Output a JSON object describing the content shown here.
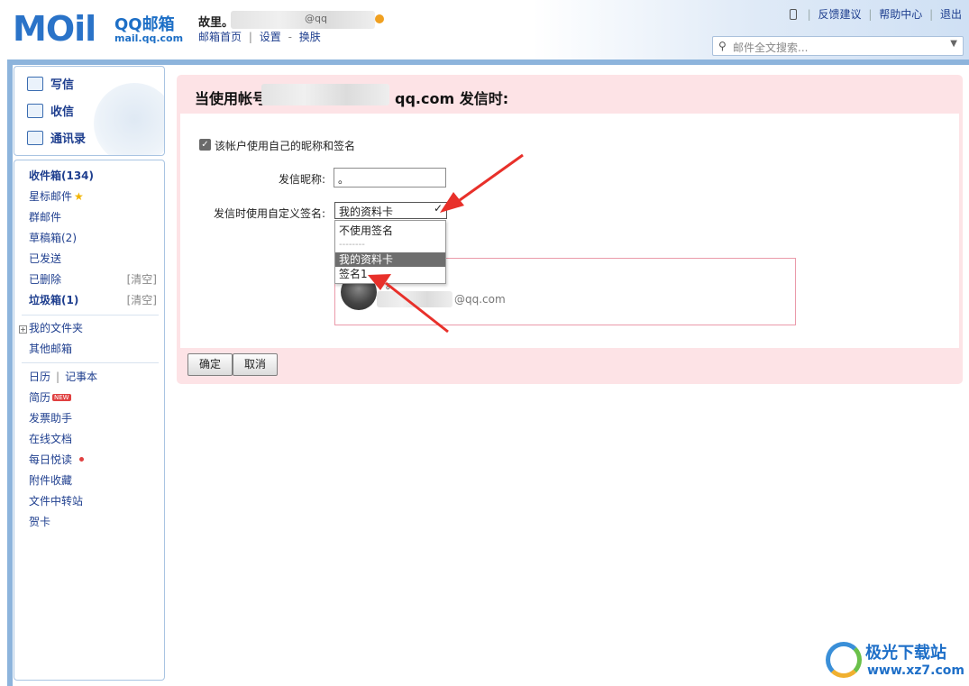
{
  "header": {
    "logo_text": "MOil",
    "logo_brand": "QQ邮箱",
    "logo_url": "mail.qq.com",
    "username": "故里。",
    "email_fragment": "@qq",
    "links": [
      "邮箱首页",
      "设置",
      "换肤"
    ],
    "link_seps": [
      "|",
      "-"
    ],
    "top_links": [
      "反馈建议",
      "帮助中心",
      "退出"
    ],
    "top_seps": [
      "|",
      "|",
      "|"
    ],
    "search_placeholder": "邮件全文搜索..."
  },
  "sidebar": {
    "actions": [
      "写信",
      "收信",
      "通讯录"
    ],
    "folders": {
      "inbox": "收件箱(134)",
      "starred": "星标邮件",
      "group": "群邮件",
      "drafts": "草稿箱(2)",
      "sent": "已发送",
      "deleted": "已删除",
      "deleted_clear": "[清空]",
      "spam": "垃圾箱(1)",
      "spam_clear": "[清空]",
      "my_folders": "我的文件夹",
      "other_mailbox": "其他邮箱"
    },
    "apps": {
      "calendar": "日历",
      "app_sep": "|",
      "notebook": "记事本",
      "resume": "简历",
      "new_badge": "NEW",
      "invoice": "发票助手",
      "docs": "在线文档",
      "daily": "每日悦读",
      "attachments": "附件收藏",
      "transfer": "文件中转站",
      "card": "贺卡"
    }
  },
  "main": {
    "title_prefix": "当使用帐号",
    "title_suffix": "qq.com 发信时:",
    "checkbox_label": "该帐户使用自己的昵称和签名",
    "nickname_label": "发信昵称:",
    "nickname_value": "。",
    "signature_label": "发信时使用自定义签名:",
    "signature_selected": "我的资料卡",
    "dropdown_options": [
      "不使用签名",
      "--------",
      "我的资料卡",
      "签名1"
    ],
    "preview_name": "。",
    "preview_email": "@qq.com",
    "ok_button": "确定",
    "cancel_button": "取消"
  },
  "watermark": {
    "title": "极光下载站",
    "url": "www.xz7.com"
  },
  "colors": {
    "panel_bg": "#fde3e6",
    "frame_blue": "#8db4dc",
    "link_blue": "#1f3f8f",
    "arrow_red": "#e8302a"
  }
}
